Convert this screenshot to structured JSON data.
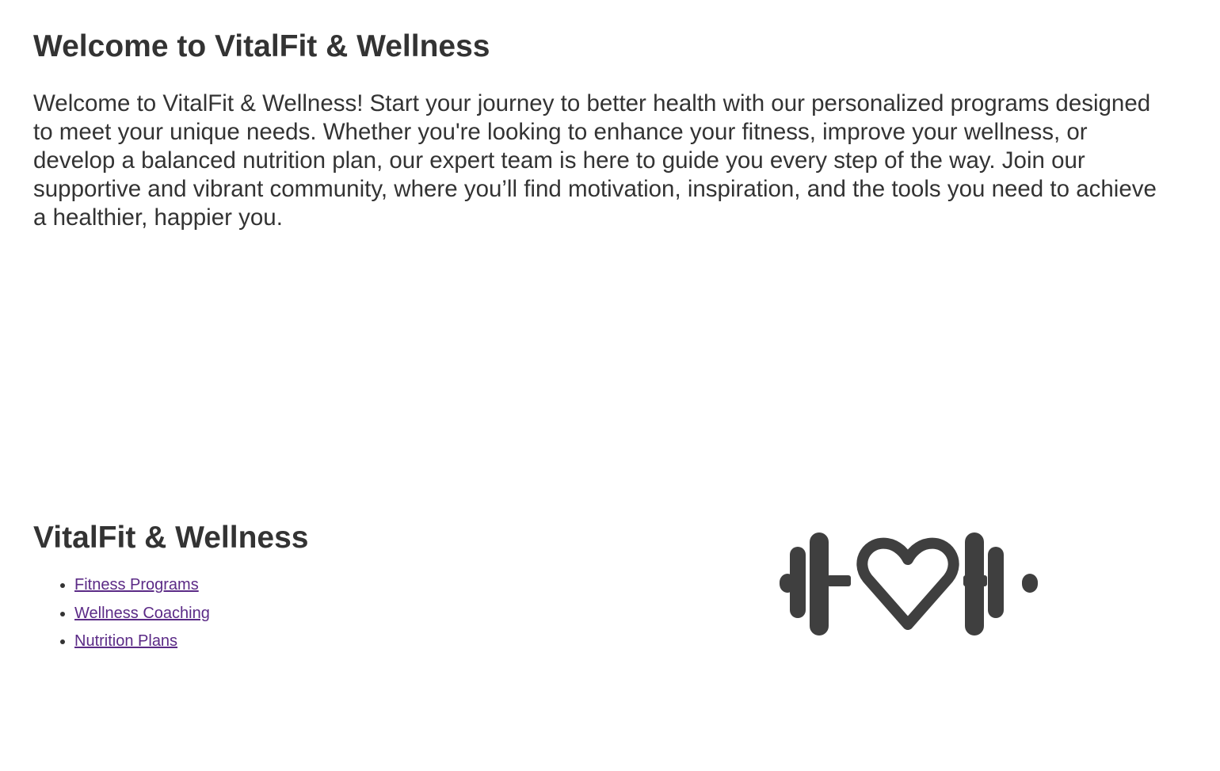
{
  "hero": {
    "title": "Welcome to VitalFit & Wellness",
    "text": "Welcome to VitalFit & Wellness! Start your journey to better health with our personalized programs designed to meet your unique needs. Whether you're looking to enhance your fitness, improve your wellness, or develop a balanced nutrition plan, our expert team is here to guide you every step of the way. Join our supportive and vibrant community, where you’ll find motivation, inspiration, and the tools you need to achieve a healthier, happier you."
  },
  "footer": {
    "brand": "VitalFit & Wellness",
    "links": [
      {
        "label": "Fitness Programs"
      },
      {
        "label": "Wellness Coaching"
      },
      {
        "label": "Nutrition Plans"
      }
    ]
  },
  "logo": {
    "icon": "dumbbell-heart-icon",
    "color": "#3f3f3f"
  },
  "colors": {
    "text": "#333333",
    "link_visited": "#5b2a86",
    "background": "#ffffff"
  }
}
